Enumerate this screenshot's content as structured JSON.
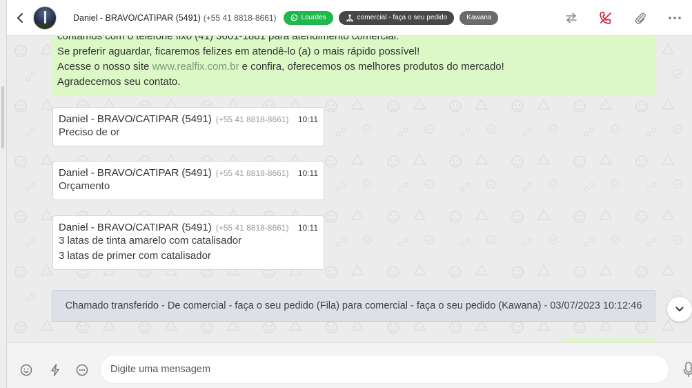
{
  "header": {
    "contact_name": "Daniel - BRAVO/CATIPAR (5491)",
    "contact_phone": "(+55 41 8818-8661)",
    "tags": [
      {
        "label": "Lourdes",
        "icon": "whatsapp-icon",
        "color": "#1eb84d"
      },
      {
        "label": "comercial - faça o seu pedido",
        "icon": "queue-icon",
        "color": "#474747"
      },
      {
        "label": "Kawana",
        "icon": "",
        "color": "#6a6a6a"
      }
    ],
    "actions": [
      "transfer-icon",
      "end-call-icon",
      "attach-icon",
      "more-icon"
    ]
  },
  "chat": {
    "greeting_lines": [
      "contamos com o telefone fixo (41) 3661-1861 para atendimento comercial.",
      "Se preferir aguardar, ficaremos felizes em atendê-lo (a) o mais rápido possível!",
      "Acesse o nosso site ",
      "www.realfix.com.br",
      " e confira, oferecemos os melhores produtos do mercado!",
      "Agradecemos seu contato."
    ],
    "messages": [
      {
        "author": "Daniel - BRAVO/CATIPAR (5491)",
        "phone": "(+55 41 8818-8661)",
        "time": "10:11",
        "lines": [
          "Preciso de or"
        ]
      },
      {
        "author": "Daniel - BRAVO/CATIPAR (5491)",
        "phone": "(+55 41 8818-8661)",
        "time": "10:11",
        "lines": [
          "Orçamento"
        ]
      },
      {
        "author": "Daniel - BRAVO/CATIPAR (5491)",
        "phone": "(+55 41 8818-8661)",
        "time": "10:11",
        "lines": [
          "3 latas de tinta amarelo com catalisador",
          "3 latas de primer com catalisador"
        ]
      }
    ],
    "system_message": "Chamado transferido - De comercial - faça o seu pedido (Fila) para comercial - faça o seu pedido (Kawana) - 03/07/2023 10:12:46"
  },
  "composer": {
    "placeholder": "Digite uma mensagem"
  },
  "colors": {
    "outgoing_bubble": "#dcf8c6",
    "system_banner": "#dde1e7",
    "tag_green": "#1eb84d"
  }
}
